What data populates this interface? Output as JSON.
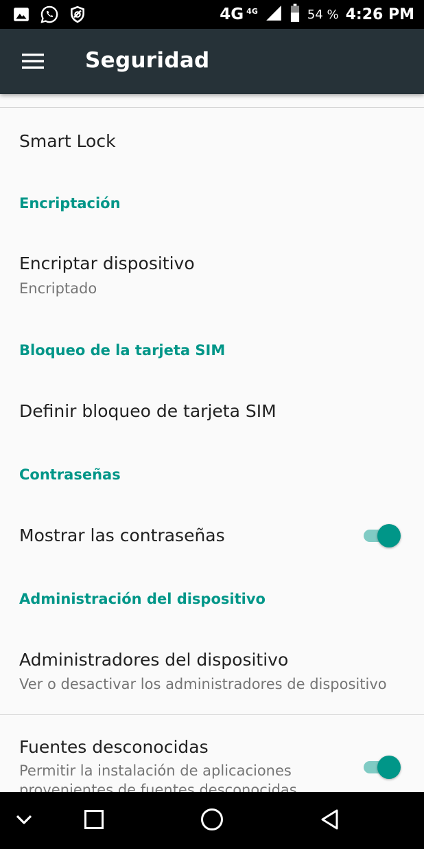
{
  "status_bar": {
    "network": "4G",
    "network_small": "4G",
    "battery_percent": "54 %",
    "time": "4:26 PM",
    "icons": [
      "image-icon",
      "whatsapp-icon",
      "shield-icon",
      "signal-icon",
      "battery-icon"
    ]
  },
  "app_bar": {
    "title": "Seguridad",
    "menu_icon": "hamburger-menu-icon"
  },
  "list": {
    "smart_lock": {
      "title": "Smart Lock"
    },
    "encryption": {
      "header": "Encriptación",
      "item": {
        "title": "Encriptar dispositivo",
        "summary": "Encriptado"
      }
    },
    "sim_lock": {
      "header": "Bloqueo de la tarjeta SIM",
      "item": {
        "title": "Definir bloqueo de tarjeta SIM"
      }
    },
    "passwords": {
      "header": "Contraseñas",
      "item": {
        "title": "Mostrar las contraseñas",
        "toggle_on": true
      }
    },
    "device_admin": {
      "header": "Administración del dispositivo",
      "item": {
        "title": "Administradores del dispositivo",
        "summary": "Ver o desactivar los administradores de dispositivo"
      },
      "unknown_sources": {
        "title": "Fuentes desconocidas",
        "summary": "Permitir la instalación de aplicaciones provenientes de fuentes desconocidas",
        "toggle_on": true
      }
    }
  },
  "colors": {
    "status_bar": "#000000",
    "app_bar": "#263238",
    "accent": "#009688",
    "accent_light": "#80cbc4",
    "background": "#fafafa",
    "primary_text": "#212121",
    "secondary_text": "#757575"
  },
  "nav_bar": {
    "icons": [
      "chevron-down-icon",
      "recents-square-icon",
      "home-circle-icon",
      "back-triangle-icon"
    ]
  }
}
